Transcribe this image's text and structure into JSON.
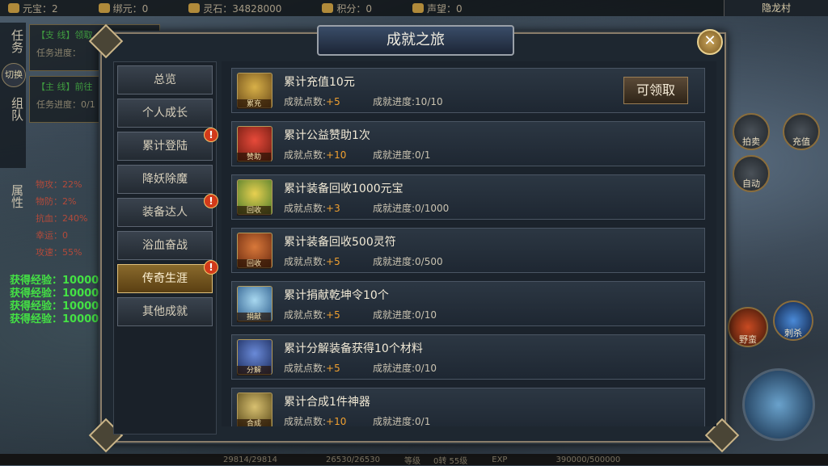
{
  "hud": {
    "top": [
      {
        "label": "元宝：2"
      },
      {
        "label": "绑元：0"
      },
      {
        "label": "灵石：34828000"
      },
      {
        "label": "积分：0"
      },
      {
        "label": "声望：0"
      }
    ],
    "map_name": "隐龙村",
    "left_tabs": [
      "任务",
      "组队"
    ],
    "switch_label": "切换",
    "attr_tab": "属性",
    "quests": [
      {
        "tag": "【支 线】领取",
        "progress": "任务进度："
      },
      {
        "tag": "【主 线】前往",
        "progress": "任务进度：0/1"
      }
    ],
    "attrs": [
      "物攻：22%",
      "物防：2%",
      "抗血：240%",
      "幸运：0",
      "攻速：55%"
    ],
    "exp": [
      "获得经验：10000",
      "获得经验：10000",
      "获得经验：10000",
      "获得经验：10000"
    ],
    "bottom": [
      "29814/29814",
      "26530/26530",
      "等级",
      "0转 55级",
      "EXP",
      "390000/500000"
    ],
    "right_btns": [
      "拍卖",
      "充值",
      "自动"
    ],
    "skills": [
      "野蛮",
      "刺杀"
    ]
  },
  "dialog": {
    "title": "成就之旅",
    "close": "✕",
    "nav": [
      {
        "label": "总览",
        "badge": false,
        "active": false
      },
      {
        "label": "个人成长",
        "badge": false,
        "active": false
      },
      {
        "label": "累计登陆",
        "badge": true,
        "active": false
      },
      {
        "label": "降妖除魔",
        "badge": false,
        "active": false
      },
      {
        "label": "装备达人",
        "badge": true,
        "active": false
      },
      {
        "label": "浴血奋战",
        "badge": false,
        "active": false
      },
      {
        "label": "传奇生涯",
        "badge": true,
        "active": true
      },
      {
        "label": "其他成就",
        "badge": false,
        "active": false
      }
    ],
    "badge_glyph": "!",
    "points_label": "成就点数:",
    "progress_label": "成就进度:",
    "claim_label": "可领取",
    "items": [
      {
        "icon": "累充",
        "title": "累计充值10元",
        "points": "+5",
        "progress": "10/10",
        "claimable": true
      },
      {
        "icon": "赞助",
        "title": "累计公益赞助1次",
        "points": "+10",
        "progress": "0/1",
        "claimable": false
      },
      {
        "icon": "回收",
        "title": "累计装备回收1000元宝",
        "points": "+3",
        "progress": "0/1000",
        "claimable": false
      },
      {
        "icon": "回收",
        "title": "累计装备回收500灵符",
        "points": "+5",
        "progress": "0/500",
        "claimable": false
      },
      {
        "icon": "捐献",
        "title": "累计捐献乾坤令10个",
        "points": "+5",
        "progress": "0/10",
        "claimable": false
      },
      {
        "icon": "分解",
        "title": "累计分解装备获得10个材料",
        "points": "+5",
        "progress": "0/10",
        "claimable": false
      },
      {
        "icon": "合成",
        "title": "累计合成1件神器",
        "points": "+10",
        "progress": "0/1",
        "claimable": false
      }
    ]
  }
}
